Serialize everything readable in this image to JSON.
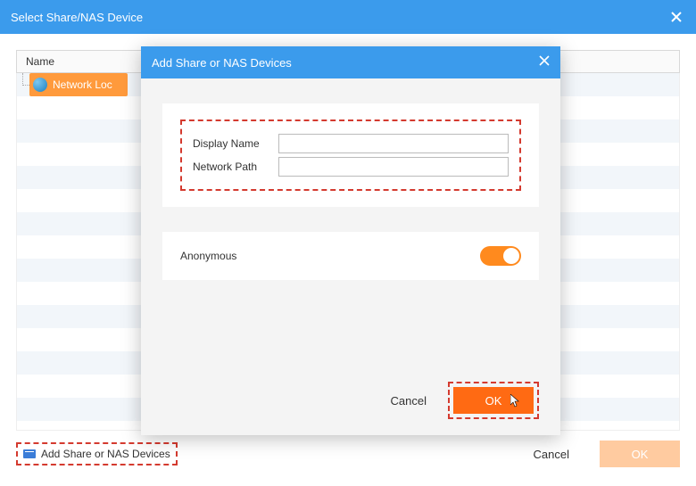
{
  "outer": {
    "title": "Select Share/NAS Device",
    "name_header": "Name",
    "tree_item": "Network Loc",
    "add_share_label": "Add Share or NAS Devices",
    "cancel_label": "Cancel",
    "ok_label": "OK"
  },
  "modal": {
    "title": "Add Share or NAS Devices",
    "display_name_label": "Display Name",
    "display_name_value": "",
    "network_path_label": "Network Path",
    "network_path_value": "",
    "anonymous_label": "Anonymous",
    "anonymous_on": true,
    "cancel_label": "Cancel",
    "ok_label": "OK"
  },
  "colors": {
    "titlebar": "#3b9bec",
    "accent": "#ff6a13",
    "highlight_dash": "#d43a2f",
    "selection": "#ff9a3c"
  }
}
